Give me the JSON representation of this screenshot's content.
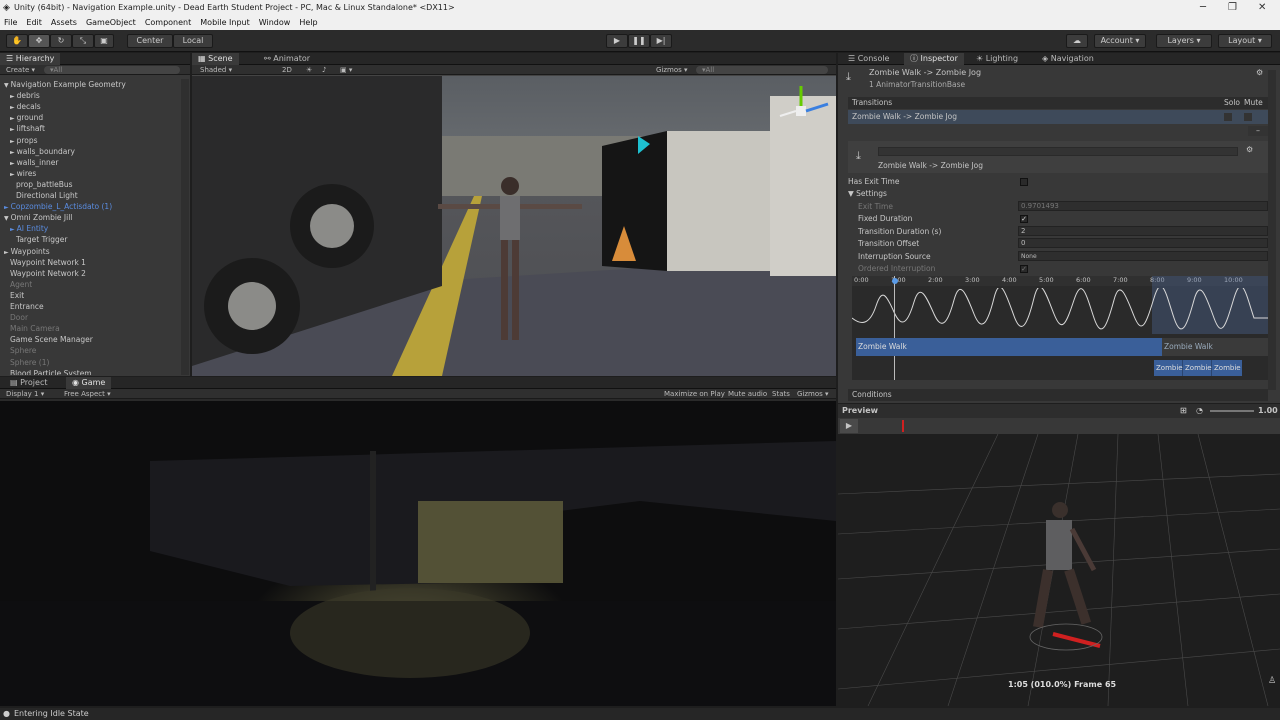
{
  "window": {
    "title": "Unity (64bit) - Navigation Example.unity - Dead Earth Student Project - PC, Mac & Linux Standalone* <DX11>"
  },
  "menu": [
    "File",
    "Edit",
    "Assets",
    "GameObject",
    "Component",
    "Mobile Input",
    "Window",
    "Help"
  ],
  "toolbar": {
    "center": "Center",
    "local": "Local",
    "account": "Account",
    "layers": "Layers",
    "layout": "Layout"
  },
  "hierarchy": {
    "tab": "Hierarchy",
    "create": "Create",
    "search": "▾All",
    "rows": [
      {
        "label": "Navigation Example Geometry",
        "indent": 0,
        "style": "normal",
        "arrow": "▼"
      },
      {
        "label": "debris",
        "indent": 1,
        "style": "normal",
        "arrow": "►"
      },
      {
        "label": "decals",
        "indent": 1,
        "style": "normal",
        "arrow": "►"
      },
      {
        "label": "ground",
        "indent": 1,
        "style": "normal",
        "arrow": "►"
      },
      {
        "label": "liftshaft",
        "indent": 1,
        "style": "normal",
        "arrow": "►"
      },
      {
        "label": "props",
        "indent": 1,
        "style": "normal",
        "arrow": "►"
      },
      {
        "label": "walls_boundary",
        "indent": 1,
        "style": "normal",
        "arrow": "►"
      },
      {
        "label": "walls_inner",
        "indent": 1,
        "style": "normal",
        "arrow": "►"
      },
      {
        "label": "wires",
        "indent": 1,
        "style": "normal",
        "arrow": "►"
      },
      {
        "label": "prop_battleBus",
        "indent": 2,
        "style": "normal",
        "arrow": ""
      },
      {
        "label": "Directional Light",
        "indent": 2,
        "style": "normal",
        "arrow": ""
      },
      {
        "label": "Copzombie_L_Actisdato (1)",
        "indent": 0,
        "style": "blue",
        "arrow": "►"
      },
      {
        "label": "Omni Zombie Jill",
        "indent": 0,
        "style": "normal",
        "arrow": "▼"
      },
      {
        "label": "AI Entity",
        "indent": 1,
        "style": "blue",
        "arrow": "►"
      },
      {
        "label": "Target Trigger",
        "indent": 2,
        "style": "normal",
        "arrow": ""
      },
      {
        "label": "Waypoints",
        "indent": 0,
        "style": "normal",
        "arrow": "►"
      },
      {
        "label": "Waypoint Network 1",
        "indent": 1,
        "style": "normal",
        "arrow": ""
      },
      {
        "label": "Waypoint Network 2",
        "indent": 1,
        "style": "normal",
        "arrow": ""
      },
      {
        "label": "Agent",
        "indent": 1,
        "style": "dim",
        "arrow": ""
      },
      {
        "label": "Exit",
        "indent": 1,
        "style": "normal",
        "arrow": ""
      },
      {
        "label": "Entrance",
        "indent": 1,
        "style": "normal",
        "arrow": ""
      },
      {
        "label": "Door",
        "indent": 1,
        "style": "dim",
        "arrow": ""
      },
      {
        "label": "Main Camera",
        "indent": 1,
        "style": "dim",
        "arrow": ""
      },
      {
        "label": "Game Scene Manager",
        "indent": 1,
        "style": "normal",
        "arrow": ""
      },
      {
        "label": "Sphere",
        "indent": 1,
        "style": "dim",
        "arrow": ""
      },
      {
        "label": "Sphere (1)",
        "indent": 1,
        "style": "dim",
        "arrow": ""
      },
      {
        "label": "Blood Particle System",
        "indent": 1,
        "style": "normal",
        "arrow": ""
      }
    ]
  },
  "scene": {
    "tab_scene": "Scene",
    "tab_animator": "Animator",
    "shaded": "Shaded",
    "mode2d": "2D",
    "gizmos": "Gizmos",
    "search": "▾All"
  },
  "game": {
    "tab_project": "Project",
    "tab_game": "Game",
    "display": "Display 1",
    "aspect": "Free Aspect",
    "maximize": "Maximize on Play",
    "mute": "Mute audio",
    "stats": "Stats",
    "gizmos": "Gizmos"
  },
  "inspector": {
    "tabs": [
      "Console",
      "Inspector",
      "Lighting",
      "Navigation"
    ],
    "header_title": "Zombie Walk -> Zombie Jog",
    "header_sub": "1 AnimatorTransitionBase",
    "transitions_label": "Transitions",
    "solo": "Solo",
    "mute": "Mute",
    "transition_item": "Zombie Walk -> Zombie Jog",
    "sub_title": "Zombie Walk -> Zombie Jog",
    "has_exit_time": "Has Exit Time",
    "settings": "Settings",
    "exit_time": "Exit Time",
    "exit_time_val": "0.9701493",
    "fixed_duration": "Fixed Duration",
    "transition_duration": "Transition Duration (s)",
    "transition_duration_val": "2",
    "transition_offset": "Transition Offset",
    "transition_offset_val": "0",
    "interruption_source": "Interruption Source",
    "interruption_source_val": "None",
    "ordered_interruption": "Ordered Interruption",
    "timeline_ticks": [
      "0:00",
      "1:00",
      "2:00",
      "3:00",
      "4:00",
      "5:00",
      "6:00",
      "7:00",
      "8:00",
      "9:00",
      "10:00"
    ],
    "clip_a": "Zombie Walk",
    "clip_b": "Zombie Walk",
    "clip_c": [
      "Zombie",
      "Zombie",
      "Zombie"
    ],
    "conditions": "Conditions"
  },
  "preview": {
    "title": "Preview",
    "speed": "1.00",
    "frame": "1:05 (010.0%) Frame 65"
  },
  "status": {
    "text": "Entering Idle State"
  },
  "colors": {
    "accent": "#3d6fb3",
    "clip": "#3a5f99",
    "scrub": "#d02020"
  }
}
